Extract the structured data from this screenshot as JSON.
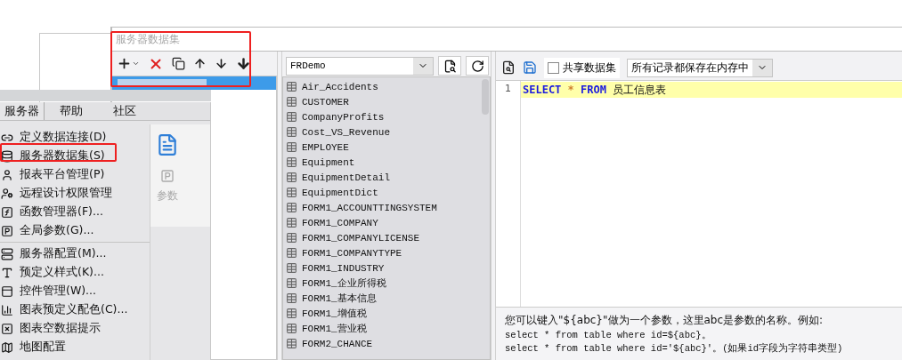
{
  "dialog": {
    "title": "服务器数据集",
    "datasets": [
      {
        "selected": true
      }
    ],
    "connection_select": {
      "value": "FRDemo"
    },
    "tables": [
      "Air_Accidents",
      "CUSTOMER",
      "CompanyProfits",
      "Cost_VS_Revenue",
      "EMPLOYEE",
      "Equipment",
      "EquipmentDetail",
      "EquipmentDict",
      "FORM1_ACCOUNTTINGSYSTEM",
      "FORM1_COMPANY",
      "FORM1_COMPANYLICENSE",
      "FORM1_COMPANYTYPE",
      "FORM1_INDUSTRY",
      "FORM1_企业所得税",
      "FORM1_基本信息",
      "FORM1_增值税",
      "FORM1_营业税",
      "FORM2_CHANCE"
    ],
    "share_checkbox": {
      "label": "共享数据集",
      "checked": false
    },
    "cache_select": {
      "value": "所有记录都保存在内存中"
    },
    "sql": {
      "line_number": "1",
      "tokens": [
        {
          "kind": "keyword",
          "text": "SELECT"
        },
        {
          "kind": "operator",
          "text": "*"
        },
        {
          "kind": "keyword",
          "text": "FROM"
        },
        {
          "kind": "name",
          "text": "员工信息表"
        }
      ]
    },
    "hint": [
      "您可以键入\"${abc}\"做为一个参数，这里abc是参数的名称。例如:",
      "select * from table where id=${abc}。",
      "select * from table where id='${abc}'。(如果id字段为字符串类型)"
    ]
  },
  "menu": {
    "tabs": [
      {
        "label": "服务器",
        "selected": true
      },
      {
        "label": "帮助",
        "selected": false
      },
      {
        "label": "社区",
        "selected": false
      }
    ],
    "items": [
      {
        "kind": "item",
        "label": "定义数据连接(D)"
      },
      {
        "kind": "item",
        "label": "服务器数据集(S)"
      },
      {
        "kind": "item",
        "label": "报表平台管理(P)"
      },
      {
        "kind": "item",
        "label": "远程设计权限管理"
      },
      {
        "kind": "item",
        "label": "函数管理器(F)..."
      },
      {
        "kind": "item",
        "label": "全局参数(G)..."
      },
      {
        "kind": "separator"
      },
      {
        "kind": "item",
        "label": "服务器配置(M)..."
      },
      {
        "kind": "item",
        "label": "预定义样式(K)..."
      },
      {
        "kind": "item",
        "label": "控件管理(W)..."
      },
      {
        "kind": "item",
        "label": "图表预定义配色(C)..."
      },
      {
        "kind": "item",
        "label": "图表空数据提示"
      },
      {
        "kind": "item",
        "label": "地图配置"
      }
    ],
    "param_button": {
      "label": "参数",
      "disabled": true
    }
  }
}
